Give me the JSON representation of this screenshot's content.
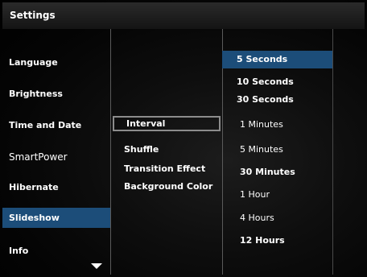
{
  "title": "Settings",
  "menu": [
    {
      "label": "Language"
    },
    {
      "label": "Brightness"
    },
    {
      "label": "Time and Date"
    },
    {
      "label": "SmartPower"
    },
    {
      "label": "Hibernate"
    },
    {
      "label": "Slideshow",
      "selected": true
    },
    {
      "label": "Info"
    }
  ],
  "submenu": [
    {
      "label": "Interval",
      "focused": true
    },
    {
      "label": "Shuffle"
    },
    {
      "label": "Transition Effect"
    },
    {
      "label": "Background Color"
    }
  ],
  "options": [
    {
      "label": "5 Seconds",
      "selected": true
    },
    {
      "label": "10 Seconds"
    },
    {
      "label": "30 Seconds"
    },
    {
      "label": "1 Minutes"
    },
    {
      "label": "5 Minutes"
    },
    {
      "label": "30 Minutes"
    },
    {
      "label": "1 Hour"
    },
    {
      "label": "4 Hours"
    },
    {
      "label": "12 Hours"
    }
  ],
  "scroll_icon": "chevron-down-icon",
  "colors": {
    "highlight": "#1c4d79",
    "focus_border": "#8c8c8c"
  }
}
